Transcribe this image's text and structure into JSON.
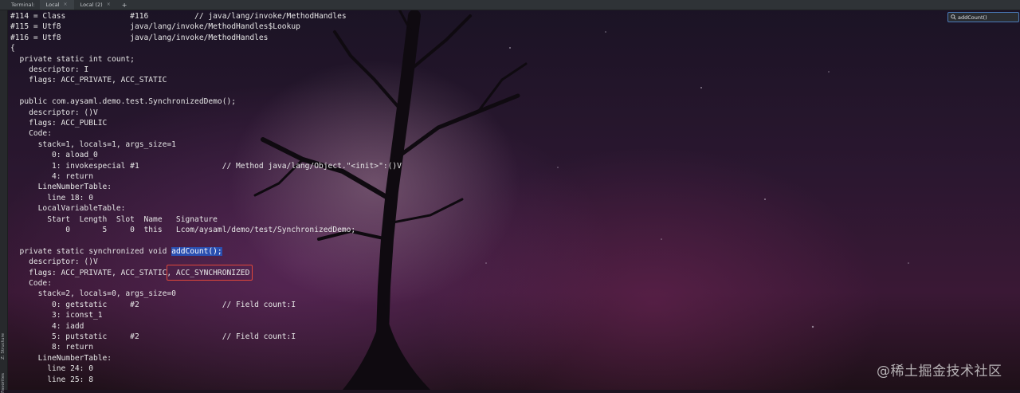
{
  "tabbar": {
    "label": "Terminal:",
    "tabs": [
      {
        "label": "Local",
        "close": "×"
      },
      {
        "label": "Local (2)",
        "close": "×"
      }
    ],
    "add": "+"
  },
  "find": {
    "icon": "search-icon",
    "value": "addCount()"
  },
  "gutter": {
    "structure": "Z: Structure",
    "favorites": "Favorites"
  },
  "lines": [
    "#114 = Class              #116          // java/lang/invoke/MethodHandles",
    "#115 = Utf8               java/lang/invoke/MethodHandles$Lookup",
    "#116 = Utf8               java/lang/invoke/MethodHandles",
    "{",
    "  private static int count;",
    "    descriptor: I",
    "    flags: ACC_PRIVATE, ACC_STATIC",
    "",
    "  public com.aysaml.demo.test.SynchronizedDemo();",
    "    descriptor: ()V",
    "    flags: ACC_PUBLIC",
    "    Code:",
    "      stack=1, locals=1, args_size=1",
    "         0: aload_0",
    "         1: invokespecial #1                  // Method java/lang/Object.\"<init>\":()V",
    "         4: return",
    "      LineNumberTable:",
    "        line 18: 0",
    "      LocalVariableTable:",
    "        Start  Length  Slot  Name   Signature",
    "            0       5     0  this   Lcom/aysaml/demo/test/SynchronizedDemo;",
    "",
    "  private static synchronized void ",
    "    descriptor: ()V",
    "    flags: ACC_PRIVATE, ACC_STATIC, ACC_SYNCHRONIZED",
    "    Code:",
    "      stack=2, locals=0, args_size=0",
    "         0: getstatic     #2                  // Field count:I",
    "         3: iconst_1",
    "         4: iadd",
    "         5: putstatic     #2                  // Field count:I",
    "         8: return",
    "      LineNumberTable:",
    "        line 24: 0",
    "        line 25: 8"
  ],
  "highlight": "addCount();",
  "boxed_flag": "ACC_SYNCHRONIZED",
  "watermark": "@稀土掘金技术社区",
  "colors": {
    "text": "#e6e6e6",
    "highlight": "#2a4fb0",
    "box": "#e0463a"
  }
}
